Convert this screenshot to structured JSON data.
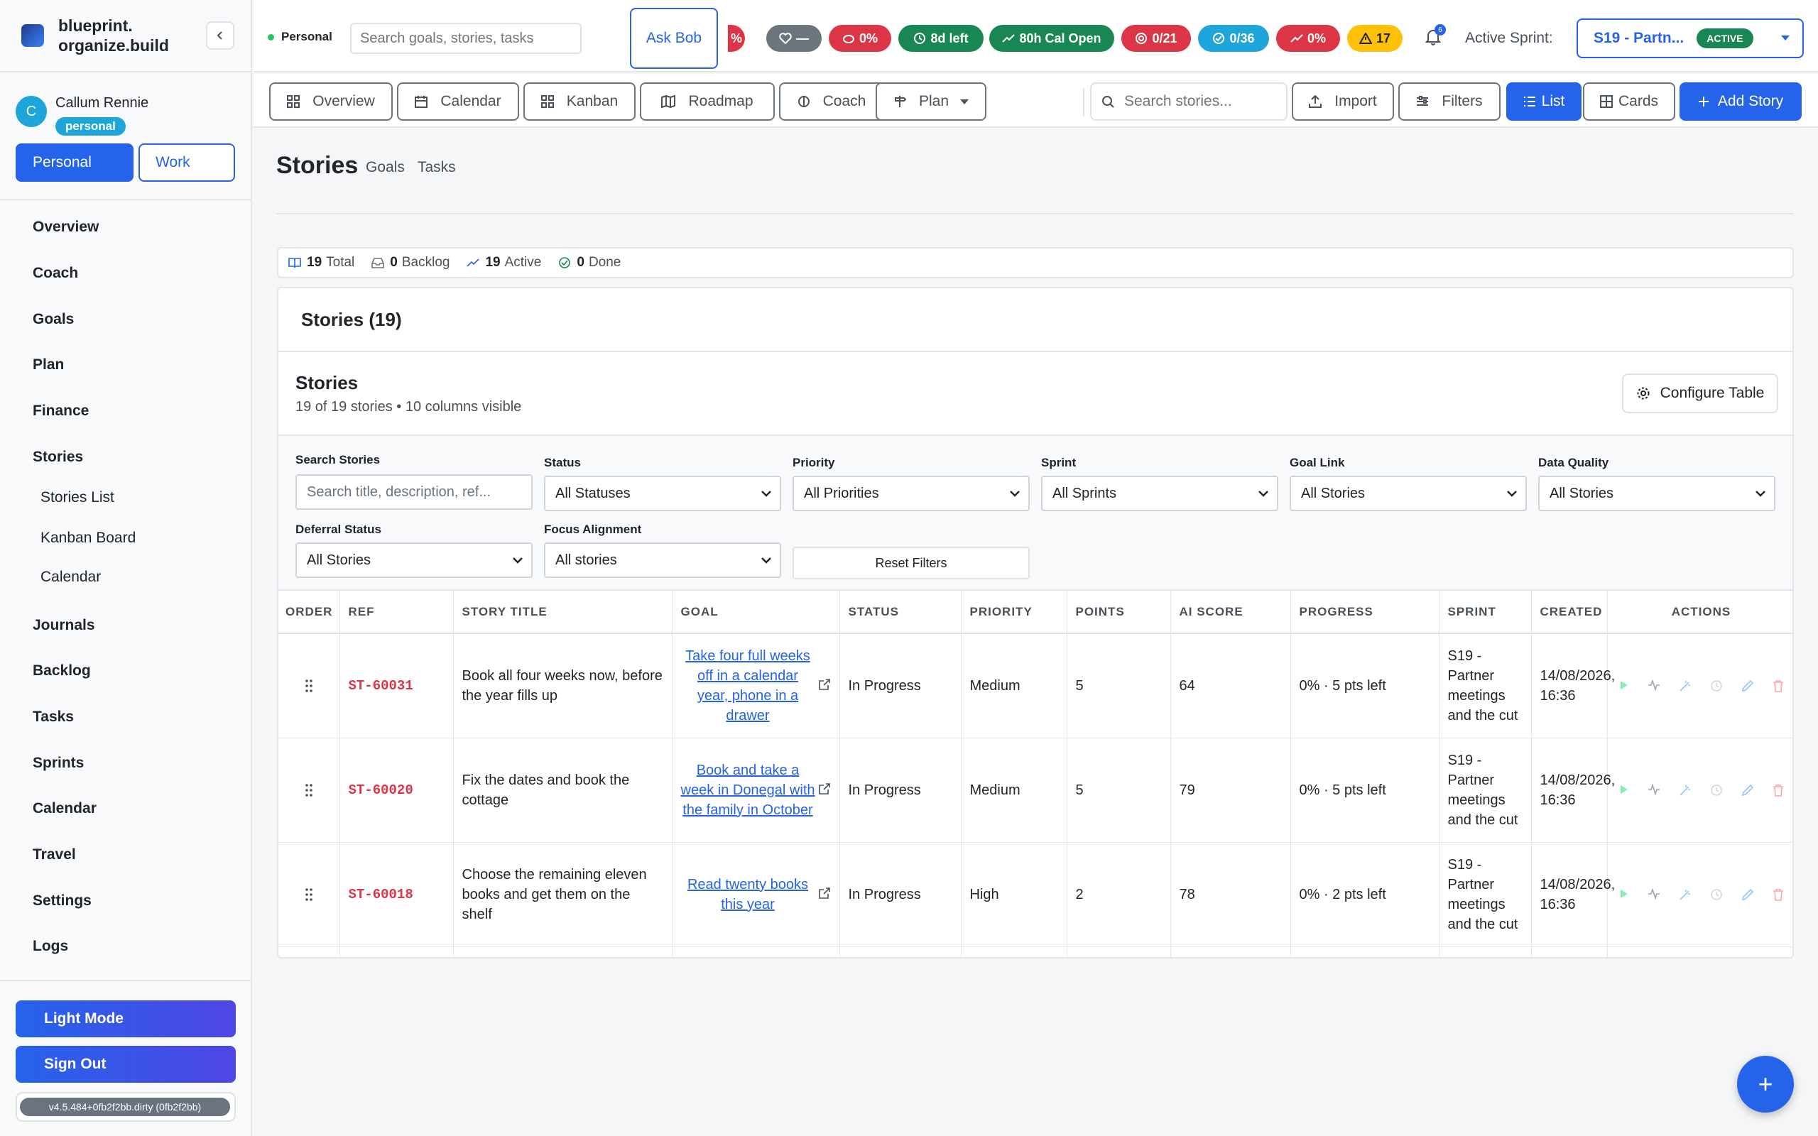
{
  "brand": {
    "name": "blueprint.\norganize.build"
  },
  "user": {
    "initial": "C",
    "name": "Callum Rennie",
    "badge": "personal"
  },
  "context": {
    "personal": "Personal",
    "work": "Work"
  },
  "nav": {
    "items": [
      "Overview",
      "Coach",
      "Goals",
      "Plan",
      "Finance",
      "Stories"
    ],
    "stories_sub": [
      "Stories List",
      "Kanban Board",
      "Calendar"
    ],
    "items2": [
      "Journals",
      "Backlog",
      "Tasks",
      "Sprints",
      "Calendar",
      "Travel",
      "Settings",
      "Logs"
    ]
  },
  "sidebar_footer": {
    "theme": "Light Mode",
    "signout": "Sign Out",
    "version": "v4.5.484+0fb2f2bb.dirty (0fb2f2bb)"
  },
  "topbar": {
    "personal": "Personal",
    "search_placeholder": "Search goals, stories, tasks",
    "ask_bob": "Ask Bob",
    "pills": [
      {
        "label": "%",
        "color": "#dc3545"
      },
      {
        "label": "—",
        "color": "#6c757d"
      },
      {
        "label": "0%",
        "color": "#dc3545"
      },
      {
        "label": "8d left",
        "color": "#198754"
      },
      {
        "label": "80h Cal Open",
        "color": "#198754"
      },
      {
        "label": "0/21",
        "color": "#dc3545"
      },
      {
        "label": "0/36",
        "color": "#1ea5d9"
      },
      {
        "label": "0%",
        "color": "#dc3545"
      },
      {
        "label": "17",
        "color": "#ffc107"
      }
    ],
    "bell_count": "6",
    "active_sprint_label": "Active Sprint:",
    "sprint_name": "S19 - Partn...",
    "sprint_badge": "ACTIVE"
  },
  "toolbar": {
    "tabs": [
      "Overview",
      "Calendar",
      "Kanban",
      "Roadmap",
      "Coach",
      "Plan"
    ],
    "search_placeholder": "Search stories...",
    "import": "Import",
    "filters": "Filters",
    "list": "List",
    "cards": "Cards",
    "add_story": "Add Story"
  },
  "page": {
    "title": "Stories",
    "subs": [
      "Goals",
      "Tasks"
    ],
    "stats": {
      "total": "19",
      "total_label": "Total",
      "backlog": "0",
      "backlog_label": "Backlog",
      "active": "19",
      "active_label": "Active",
      "done": "0",
      "done_label": "Done"
    },
    "card_title": "Stories (19)",
    "inner_title": "Stories",
    "inner_sub": "19 of 19 stories • 10 columns visible",
    "configure": "Configure Table"
  },
  "filters": {
    "search_label": "Search Stories",
    "search_placeholder": "Search title, description, ref...",
    "status_label": "Status",
    "status_value": "All Statuses",
    "priority_label": "Priority",
    "priority_value": "All Priorities",
    "sprint_label": "Sprint",
    "sprint_value": "All Sprints",
    "goal_label": "Goal Link",
    "goal_value": "All Stories",
    "quality_label": "Data Quality",
    "quality_value": "All Stories",
    "deferral_label": "Deferral Status",
    "deferral_value": "All Stories",
    "focus_label": "Focus Alignment",
    "focus_value": "All stories",
    "reset": "Reset Filters"
  },
  "table": {
    "headers": [
      "ORDER",
      "REF",
      "STORY TITLE",
      "GOAL",
      "STATUS",
      "PRIORITY",
      "POINTS",
      "AI SCORE",
      "PROGRESS",
      "SPRINT",
      "CREATED",
      "ACTIONS"
    ],
    "rows": [
      {
        "ref": "ST-60031",
        "title": "Book all four weeks now, before the year fills up",
        "goal": "Take four full weeks off in a calendar year, phone in a drawer",
        "status": "In Progress",
        "priority": "Medium",
        "points": "5",
        "ai": "64",
        "progress": "0% · 5 pts left",
        "sprint": "S19 - Partner meetings and the cut",
        "created": "14/08/2026, 16:36"
      },
      {
        "ref": "ST-60020",
        "title": "Fix the dates and book the cottage",
        "goal": "Book and take a week in Donegal with the family in October",
        "status": "In Progress",
        "priority": "Medium",
        "points": "5",
        "ai": "79",
        "progress": "0% · 5 pts left",
        "sprint": "S19 - Partner meetings and the cut",
        "created": "14/08/2026, 16:36"
      },
      {
        "ref": "ST-60018",
        "title": "Choose the remaining eleven books and get them on the shelf",
        "goal": "Read twenty books this year",
        "status": "In Progress",
        "priority": "High",
        "points": "2",
        "ai": "78",
        "progress": "0% · 2 pts left",
        "sprint": "S19 - Partner meetings and the cut",
        "created": "14/08/2026, 16:36"
      }
    ]
  },
  "fab": "+"
}
